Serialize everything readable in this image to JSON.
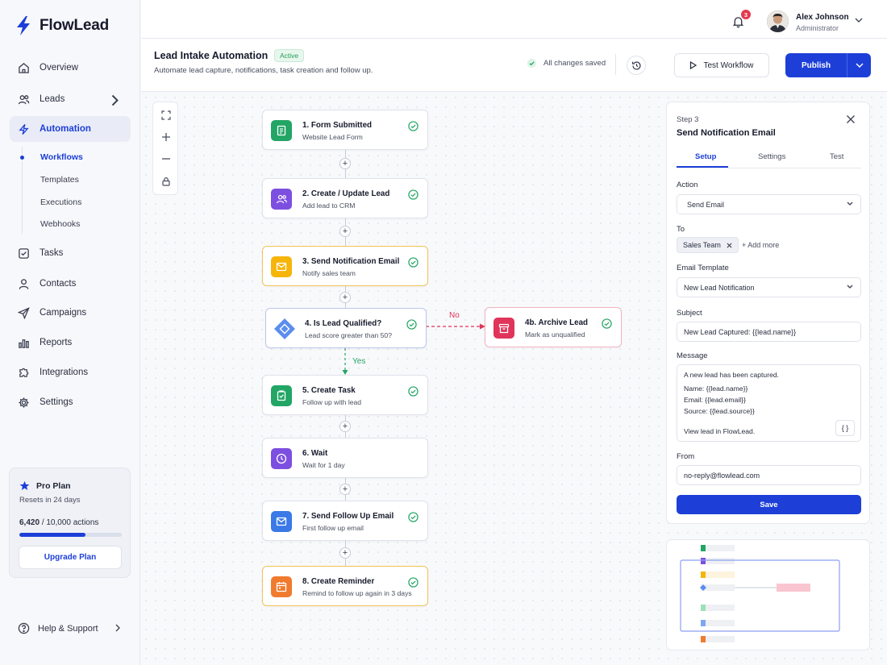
{
  "app": {
    "name": "FlowLead",
    "brand_color": "#1d3fd8"
  },
  "sidebar": {
    "items": [
      {
        "label": "Overview",
        "icon": "home-icon"
      },
      {
        "label": "Leads",
        "icon": "users-icon"
      },
      {
        "label": "Automation",
        "icon": "lightning-icon",
        "active": true
      },
      {
        "label": "Tasks",
        "icon": "checkbox-icon"
      },
      {
        "label": "Contacts",
        "icon": "user-icon"
      },
      {
        "label": "Campaigns",
        "icon": "send-icon"
      },
      {
        "label": "Reports",
        "icon": "bar-chart-icon"
      },
      {
        "label": "Integrations",
        "icon": "puzzle-icon"
      },
      {
        "label": "Settings",
        "icon": "gear-icon"
      }
    ],
    "automation_sub": [
      "Workflows",
      "Templates",
      "Executions",
      "Webhooks"
    ],
    "plan": {
      "name": "Pro Plan",
      "reset": "Resets in 24 days",
      "used": "6,420",
      "total": "/ 10,000 actions",
      "progress": 0.642,
      "upgrade_label": "Upgrade Plan"
    },
    "help_label": "Help & Support"
  },
  "topbar": {
    "notification_count": "3",
    "user_name": "Alex Johnson",
    "user_role": "Administrator"
  },
  "header": {
    "title": "Lead Intake Automation",
    "status": "Active",
    "description": "Automate lead capture, notifications, task creation and follow up.",
    "saved_text": "All changes saved",
    "test_label": "Test Workflow",
    "publish_label": "Publish"
  },
  "flow": {
    "nodes": [
      {
        "title": "1.  Form Submitted",
        "sub": "Website Lead Form",
        "color": "#22a565",
        "icon": "form-icon"
      },
      {
        "title": "2.  Create / Update Lead",
        "sub": "Add lead to CRM",
        "color": "#7d4fe0",
        "icon": "users-icon"
      },
      {
        "title": "3.  Send Notification Email",
        "sub": "Notify sales team",
        "color": "#f5b50a",
        "icon": "mail-icon"
      },
      {
        "title": "4.  Is Lead Qualified?",
        "sub": "Lead score greater than 50?",
        "color": "#5b8def",
        "icon": "diamond-icon"
      },
      {
        "title": "5.  Create Task",
        "sub": "Follow up with lead",
        "color": "#22a565",
        "icon": "clipboard-check-icon"
      },
      {
        "title": "6.  Wait",
        "sub": "Wait for 1 day",
        "color": "#7d4fe0",
        "icon": "clock-icon"
      },
      {
        "title": "7.  Send Follow Up Email",
        "sub": "First follow up email",
        "color": "#3a79e6",
        "icon": "mail-icon"
      },
      {
        "title": "8.  Create Reminder",
        "sub": "Remind to follow up again in 3 days",
        "color": "#f07b2e",
        "icon": "calendar-icon"
      }
    ],
    "branch": {
      "title": "4b. Archive Lead",
      "sub": "Mark as unqualified",
      "color": "#e0345a",
      "icon": "archive-icon"
    },
    "yes_label": "Yes",
    "no_label": "No"
  },
  "panel": {
    "step": "Step 3",
    "title": "Send Notification Email",
    "tabs": [
      "Setup",
      "Settings",
      "Test"
    ],
    "action_label": "Action",
    "action_value": "Send Email",
    "to_label": "To",
    "to_chip": "Sales Team",
    "add_more": "+ Add more",
    "template_label": "Email Template",
    "template_value": "New Lead Notification",
    "subject_label": "Subject",
    "subject_value": "New Lead Captured: {{lead.name}}",
    "message_label": "Message",
    "message_lines": [
      "A new lead has been captured.",
      "Name:  {{lead.name}}",
      "Email:  {{lead.email}}",
      "Source:  {{lead.source}}",
      "View lead in FlowLead."
    ],
    "var_button": "{ }",
    "from_label": "From",
    "from_value": "no-reply@flowlead.com",
    "save_label": "Save"
  }
}
